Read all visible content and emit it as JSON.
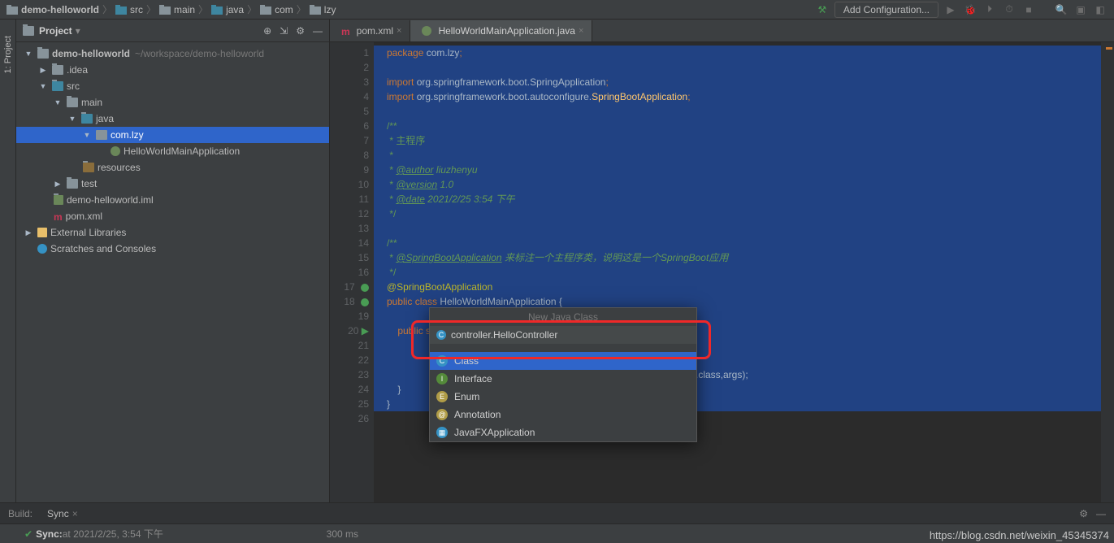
{
  "breadcrumbs": [
    "demo-helloworld",
    "src",
    "main",
    "java",
    "com",
    "lzy"
  ],
  "toolbar": {
    "add_config": "Add Configuration..."
  },
  "panel": {
    "title": "Project"
  },
  "tree": {
    "root": "demo-helloworld",
    "root_path": "~/workspace/demo-helloworld",
    "items": {
      "idea": ".idea",
      "src": "src",
      "main": "main",
      "java": "java",
      "pkg": "com.lzy",
      "app": "HelloWorldMainApplication",
      "resources": "resources",
      "test": "test",
      "iml": "demo-helloworld.iml",
      "pom": "pom.xml",
      "ext": "External Libraries",
      "scratch": "Scratches and Consoles"
    }
  },
  "tabs": {
    "pom": "pom.xml",
    "app": "HelloWorldMainApplication.java"
  },
  "code": {
    "l1a": "package ",
    "l1b": "com.lzy",
    "l1c": ";",
    "l3a": "import ",
    "l3b": "org.springframework.boot.SpringApplication",
    "l3c": ";",
    "l4a": "import ",
    "l4b": "org.springframework.boot.autoconfigure.",
    "l4c": "SpringBootApplication",
    "l4d": ";",
    "l6": "/**",
    "l7": " * 主程序",
    "l8": " *",
    "l9a": " * ",
    "l9b": "@author",
    "l9c": " liuzhenyu",
    "l10a": " * ",
    "l10b": "@version",
    "l10c": " 1.0",
    "l11a": " * ",
    "l11b": "@date",
    "l11c": " 2021/2/25 3:54 下午",
    "l12": " */",
    "l14": "/**",
    "l15a": " * ",
    "l15b": "@SpringBootApplication",
    "l15c": " 来标注一个主程序类，说明这是一个SpringBoot应用",
    "l16": " */",
    "l17": "@SpringBootApplication",
    "l18a": "public ",
    "l18b": "class ",
    "l18c": "HelloWorldMainApplication {",
    "l20a": "    public static void main(String[] args) {",
    "l23a": ".class,args);",
    "l24": "    }",
    "l25": "}"
  },
  "popup": {
    "title": "New Java Class",
    "input": "controller.HelloController",
    "items": [
      "Class",
      "Interface",
      "Enum",
      "Annotation",
      "JavaFXApplication"
    ]
  },
  "build": {
    "label": "Build:",
    "tab": "Sync"
  },
  "status": {
    "sync": "Sync:",
    "at": " at 2021/2/25, 3:54 下午",
    "ms": "300 ms"
  },
  "sidetab": {
    "project": "1: Project"
  },
  "watermark": "https://blog.csdn.net/weixin_45345374"
}
